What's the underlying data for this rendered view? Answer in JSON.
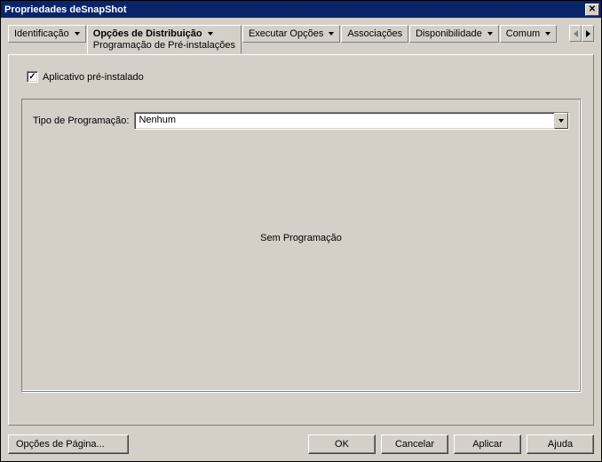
{
  "window": {
    "title": "Propriedades deSnapShot"
  },
  "tabs": {
    "identificacao": "Identificação",
    "opcoes_dist": "Opções de Distribuição",
    "opcoes_dist_sub": "Programação de Pré-instalações",
    "executar": "Executar Opções",
    "associacoes": "Associações",
    "disponibilidade": "Disponibilidade",
    "comum": "Comum"
  },
  "checkbox": {
    "label": "Aplicativo pré-instalado",
    "checked": true
  },
  "schedule": {
    "label": "Tipo de Programação:",
    "value": "Nenhum",
    "empty_text": "Sem Programação"
  },
  "buttons": {
    "page_options": "Opções de Página...",
    "ok": "OK",
    "cancel": "Cancelar",
    "apply": "Aplicar",
    "help": "Ajuda"
  }
}
